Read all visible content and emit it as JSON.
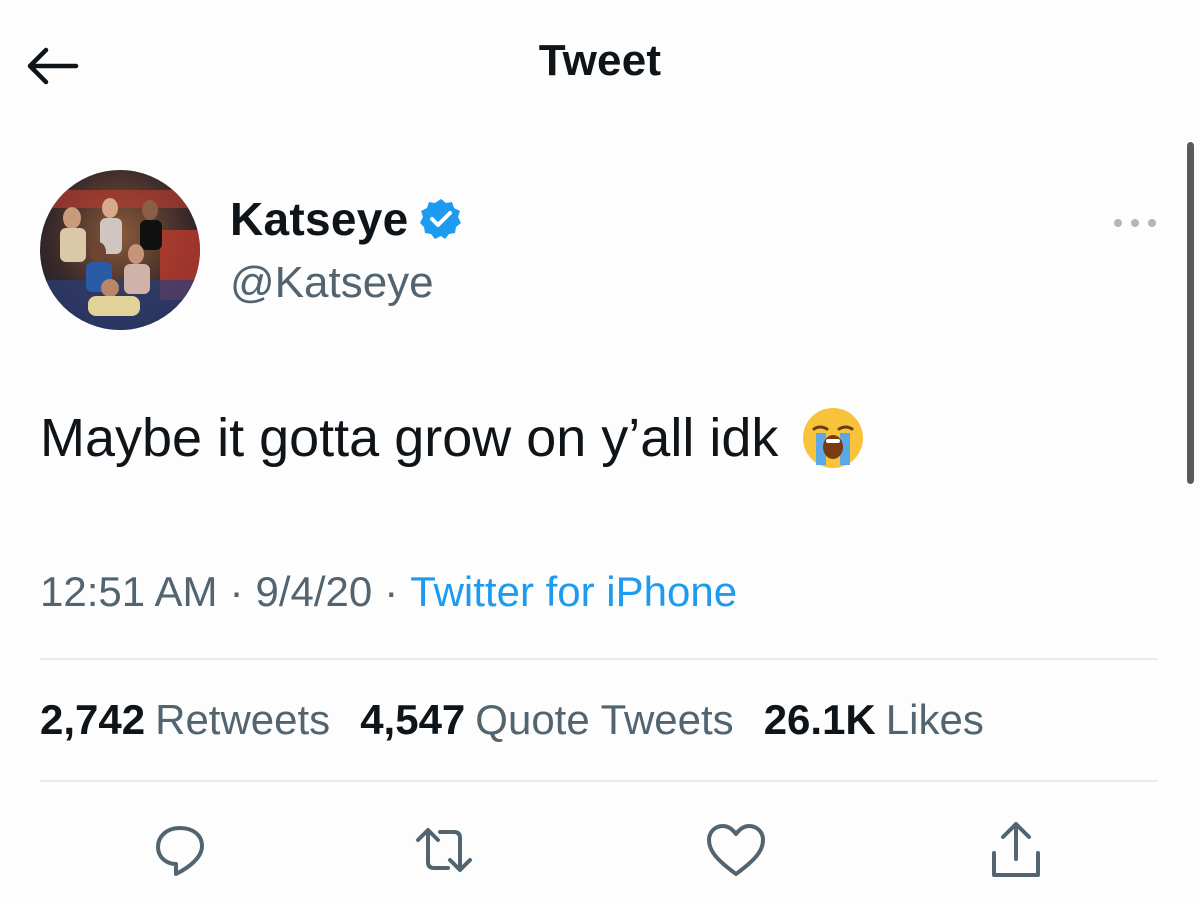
{
  "header": {
    "title": "Tweet",
    "back_icon": "arrow-left-icon"
  },
  "author": {
    "display_name": "Katseye",
    "handle": "@Katseye",
    "verified": true,
    "verified_color": "#1d9bf0"
  },
  "tweet": {
    "text": "Maybe it gotta grow on y’all idk",
    "emoji": "loudly-crying-face-icon",
    "time": "12:51 AM",
    "date": "9/4/20",
    "separator": "·",
    "source": "Twitter for iPhone"
  },
  "stats": {
    "retweets_count": "2,742",
    "retweets_label": "Retweets",
    "quotes_count": "4,547",
    "quotes_label": "Quote Tweets",
    "likes_count": "26.1K",
    "likes_label": "Likes"
  },
  "actions": [
    "reply-icon",
    "retweet-icon",
    "like-icon",
    "share-icon"
  ],
  "colors": {
    "text": "#0f1419",
    "secondary": "#536471",
    "accent": "#1d9bf0",
    "divider": "#e6ecf0"
  }
}
